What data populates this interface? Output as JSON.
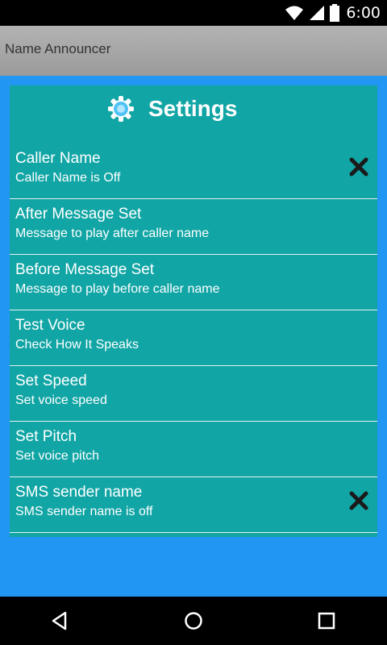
{
  "status_bar": {
    "time": "6:00",
    "icons": [
      "wifi-icon",
      "signal-icon",
      "battery-icon"
    ]
  },
  "app_bar": {
    "title": "Name Announcer"
  },
  "settings": {
    "header_icon": "gear-icon",
    "title": "Settings",
    "items": [
      {
        "title": "Caller Name",
        "subtitle": "Caller Name is Off",
        "state_icon": "x-icon"
      },
      {
        "title": "After Message Set",
        "subtitle": "Message to play after caller name"
      },
      {
        "title": "Before Message Set",
        "subtitle": "Message to play before caller name"
      },
      {
        "title": "Test Voice",
        "subtitle": "Check How It Speaks"
      },
      {
        "title": "Set Speed",
        "subtitle": "Set voice speed"
      },
      {
        "title": "Set Pitch",
        "subtitle": "Set voice pitch"
      },
      {
        "title": "SMS sender name",
        "subtitle": "SMS sender name is off",
        "state_icon": "x-icon"
      }
    ]
  },
  "nav_bar": {
    "buttons": [
      "back-icon",
      "home-icon",
      "recents-icon"
    ]
  },
  "colors": {
    "background": "#2196F3",
    "card": "#12a5a5",
    "app_bar": "#a8a8a8",
    "text": "#ffffff"
  }
}
